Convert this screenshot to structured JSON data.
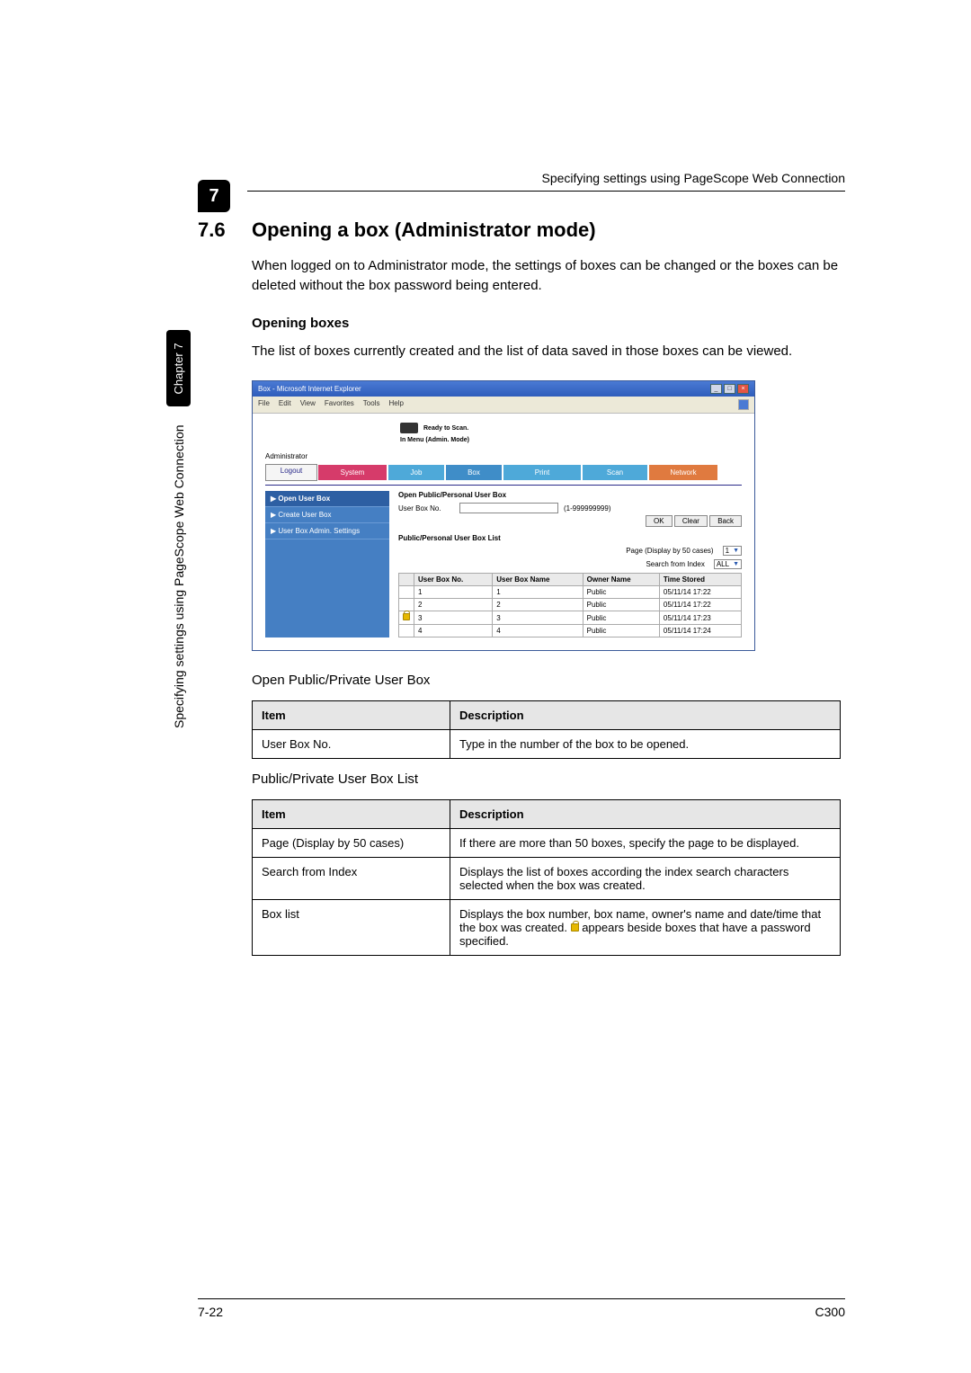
{
  "header": {
    "running_title": "Specifying settings using PageScope Web Connection"
  },
  "section_marker": "7",
  "sidebar_vertical": {
    "text": "Specifying settings using PageScope Web Connection",
    "chapter": "Chapter 7"
  },
  "section": {
    "number": "7.6",
    "title": "Opening a box (Administrator mode)",
    "intro": "When logged on to Administrator mode, the settings of boxes can be changed or the boxes can be deleted without the box password being entered.",
    "subheading": "Opening boxes",
    "subtext": "The list of boxes currently created and the list of data saved in those boxes can be viewed."
  },
  "screenshot": {
    "titlebar": "Box - Microsoft Internet Explorer",
    "menubar": [
      "File",
      "Edit",
      "View",
      "Favorites",
      "Tools",
      "Help"
    ],
    "brand": "Ready to Scan.",
    "mode": "In Menu (Admin. Mode)",
    "admin_label": "Administrator",
    "logout": "Logout",
    "nav": {
      "system": "System",
      "job": "Job",
      "box": "Box",
      "print": "Print",
      "scan": "Scan",
      "network": "Network"
    },
    "sidebar": {
      "items": [
        {
          "label": "▶ Open User Box",
          "active": true
        },
        {
          "label": "▶ Create User Box",
          "active": false
        },
        {
          "label": "▶ User Box Admin. Settings",
          "active": false
        }
      ]
    },
    "panel1": {
      "title": "Open Public/Personal User Box",
      "field_label": "User Box No.",
      "range_hint": "(1-999999999)",
      "ok": "OK",
      "clear": "Clear",
      "back": "Back"
    },
    "panel2": {
      "title": "Public/Personal User Box List",
      "page_label": "Page (Display by 50 cases)",
      "page_value": "1",
      "search_label": "Search from Index",
      "search_value": "ALL",
      "columns": [
        "",
        "User Box No.",
        "User Box Name",
        "Owner Name",
        "Time Stored"
      ],
      "rows": [
        {
          "lock": false,
          "no": "1",
          "name": "1",
          "owner": "Public",
          "time": "05/11/14 17:22"
        },
        {
          "lock": false,
          "no": "2",
          "name": "2",
          "owner": "Public",
          "time": "05/11/14 17:22"
        },
        {
          "lock": true,
          "no": "3",
          "name": "3",
          "owner": "Public",
          "time": "05/11/14 17:23"
        },
        {
          "lock": false,
          "no": "4",
          "name": "4",
          "owner": "Public",
          "time": "05/11/14 17:24"
        }
      ]
    }
  },
  "table1": {
    "caption": "Open Public/Private User Box",
    "headers": {
      "item": "Item",
      "desc": "Description"
    },
    "rows": [
      {
        "item": "User Box No.",
        "desc": "Type in the number of the box to be opened."
      }
    ]
  },
  "table2": {
    "caption": "Public/Private User Box List",
    "headers": {
      "item": "Item",
      "desc": "Description"
    },
    "rows": [
      {
        "item": "Page (Display by 50 cases)",
        "desc": "If there are more than 50 boxes, specify the page to be displayed."
      },
      {
        "item": "Search from Index",
        "desc": "Displays the list of boxes according the index search characters selected when the box was created."
      },
      {
        "item": "Box list",
        "desc_pre": "Displays the box number, box name, owner's name and date/time that the box was created. ",
        "desc_post": " appears beside boxes that have a password specified."
      }
    ]
  },
  "footer": {
    "page": "7-22",
    "model": "C300"
  }
}
